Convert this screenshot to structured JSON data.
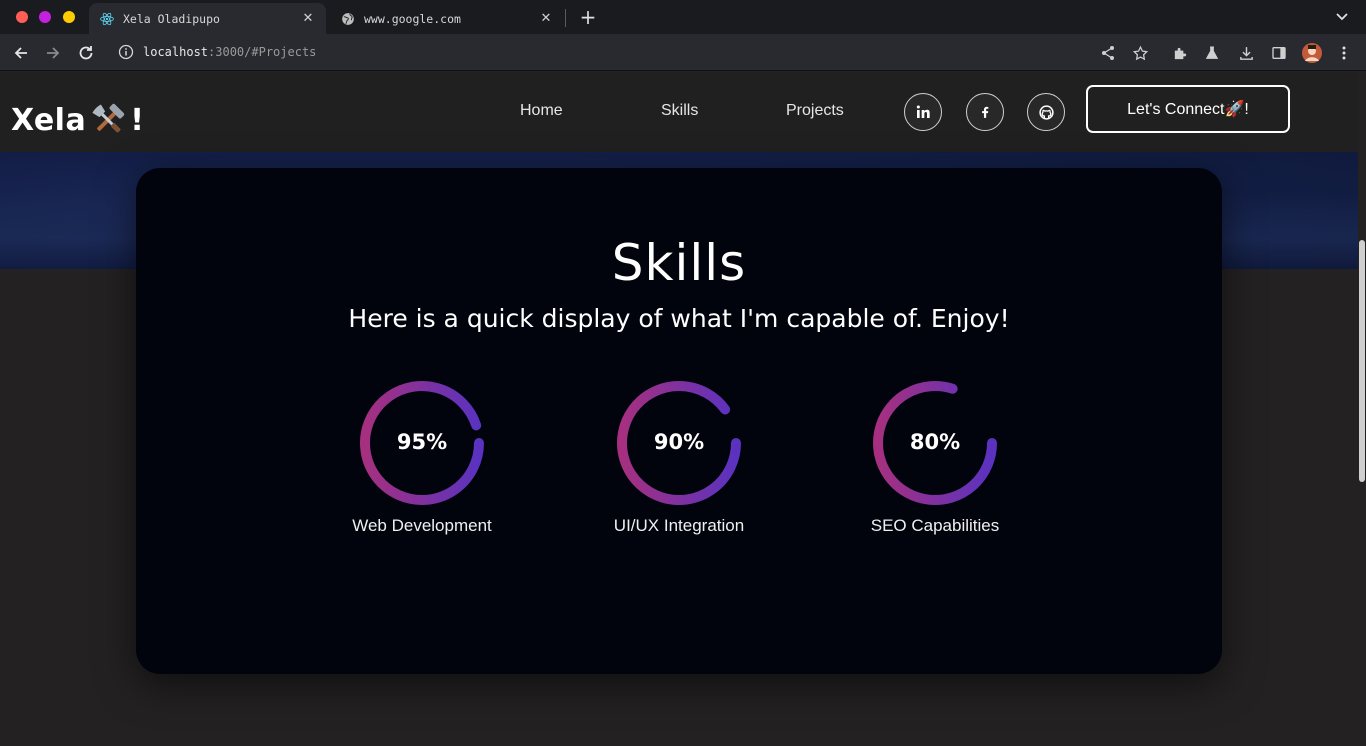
{
  "browser": {
    "tabs": [
      {
        "title": "Xela Oladipupo",
        "active": true,
        "icon": "react-icon"
      },
      {
        "title": "www.google.com",
        "active": false,
        "icon": "globe-icon"
      }
    ],
    "url": {
      "host": "localhost",
      "rest": ":3000/#Projects"
    }
  },
  "nav": {
    "logo_left": "Xela",
    "logo_right": "!",
    "links": [
      "Home",
      "Skills",
      "Projects"
    ],
    "socials": [
      "linkedin-icon",
      "facebook-icon",
      "github-icon"
    ],
    "cta": "Let's Connect🚀!"
  },
  "skills": {
    "title": "Skills",
    "subtitle": "Here is a quick display of what I'm capable of. Enjoy!",
    "items": [
      {
        "label": "Web Development",
        "percent": 95,
        "display": "95%"
      },
      {
        "label": "UI/UX Integration",
        "percent": 90,
        "display": "90%"
      },
      {
        "label": "SEO Capabilities",
        "percent": 80,
        "display": "80%"
      }
    ]
  },
  "colors": {
    "ring_start": "#a6307f",
    "ring_end": "#5a32c0",
    "card_bg": "#02040d",
    "page_bg": "#232121"
  }
}
